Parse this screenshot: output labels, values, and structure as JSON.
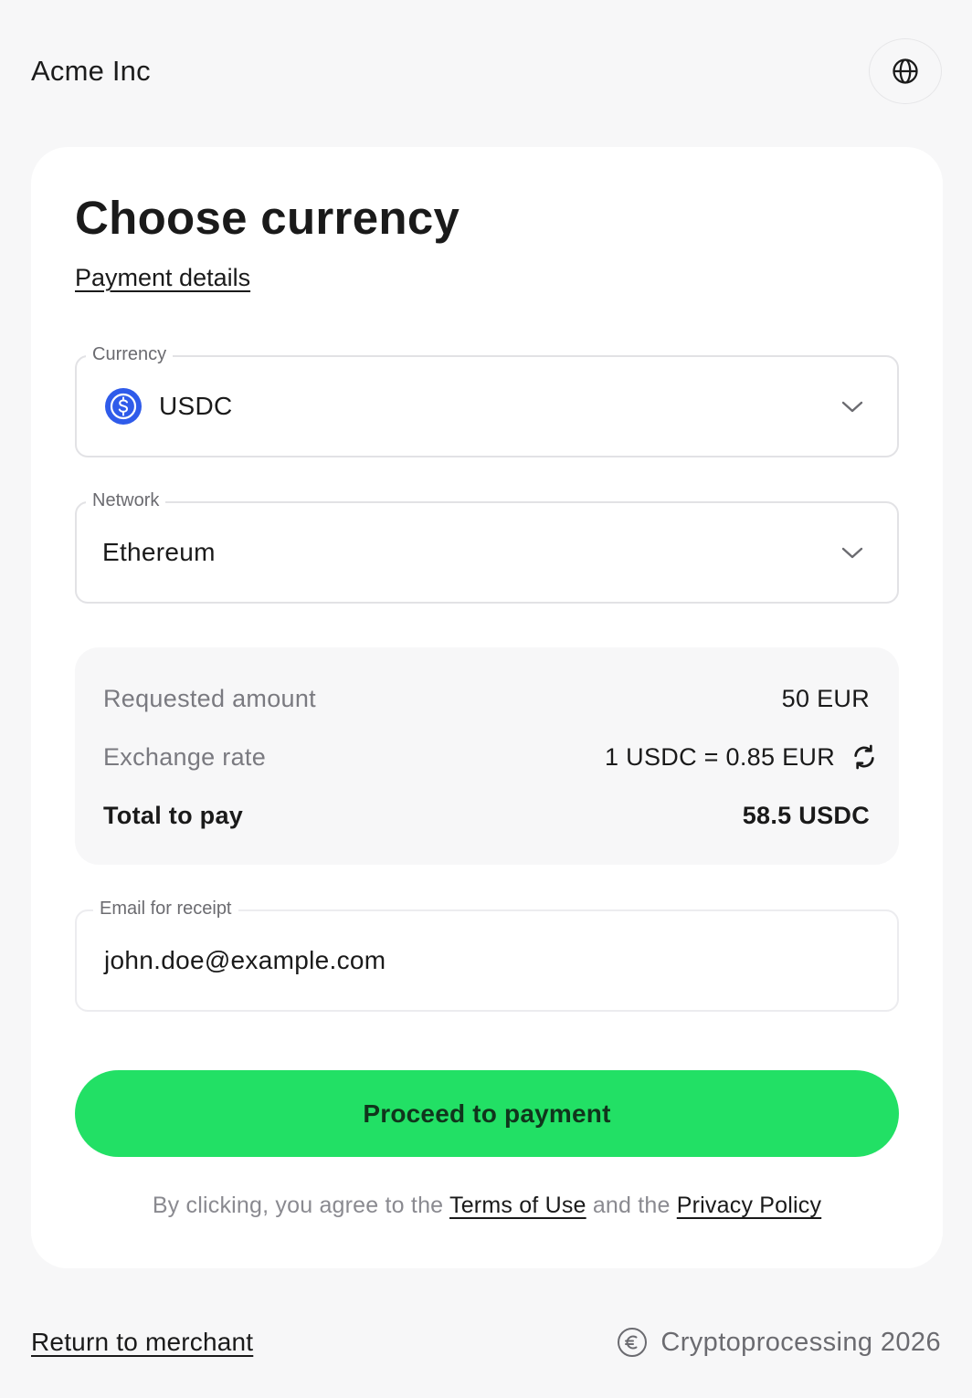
{
  "header": {
    "merchant_name": "Acme Inc",
    "language_icon": "globe-icon"
  },
  "card": {
    "title": "Choose currency",
    "details_link": "Payment details"
  },
  "currency_field": {
    "label": "Currency",
    "value": "USDC",
    "icon": "usdc-coin-icon"
  },
  "network_field": {
    "label": "Network",
    "value": "Ethereum"
  },
  "summary": {
    "requested_label": "Requested amount",
    "requested_value": "50 EUR",
    "rate_label": "Exchange rate",
    "rate_value": "1 USDC = 0.85 EUR",
    "total_label": "Total to pay",
    "total_value": "58.5 USDC"
  },
  "email_field": {
    "label": "Email for receipt",
    "value": "john.doe@example.com"
  },
  "proceed_button": "Proceed to payment",
  "legal": {
    "prefix": "By clicking, you agree to the",
    "terms": "Terms of Use",
    "middle": "and the",
    "privacy": "Privacy Policy"
  },
  "footer": {
    "return_link": "Return to merchant",
    "brand": "Cryptoprocessing 2026"
  },
  "colors": {
    "accent_green": "#22e065",
    "usdc_blue": "#2f5bea",
    "background": "#f7f7f8"
  }
}
